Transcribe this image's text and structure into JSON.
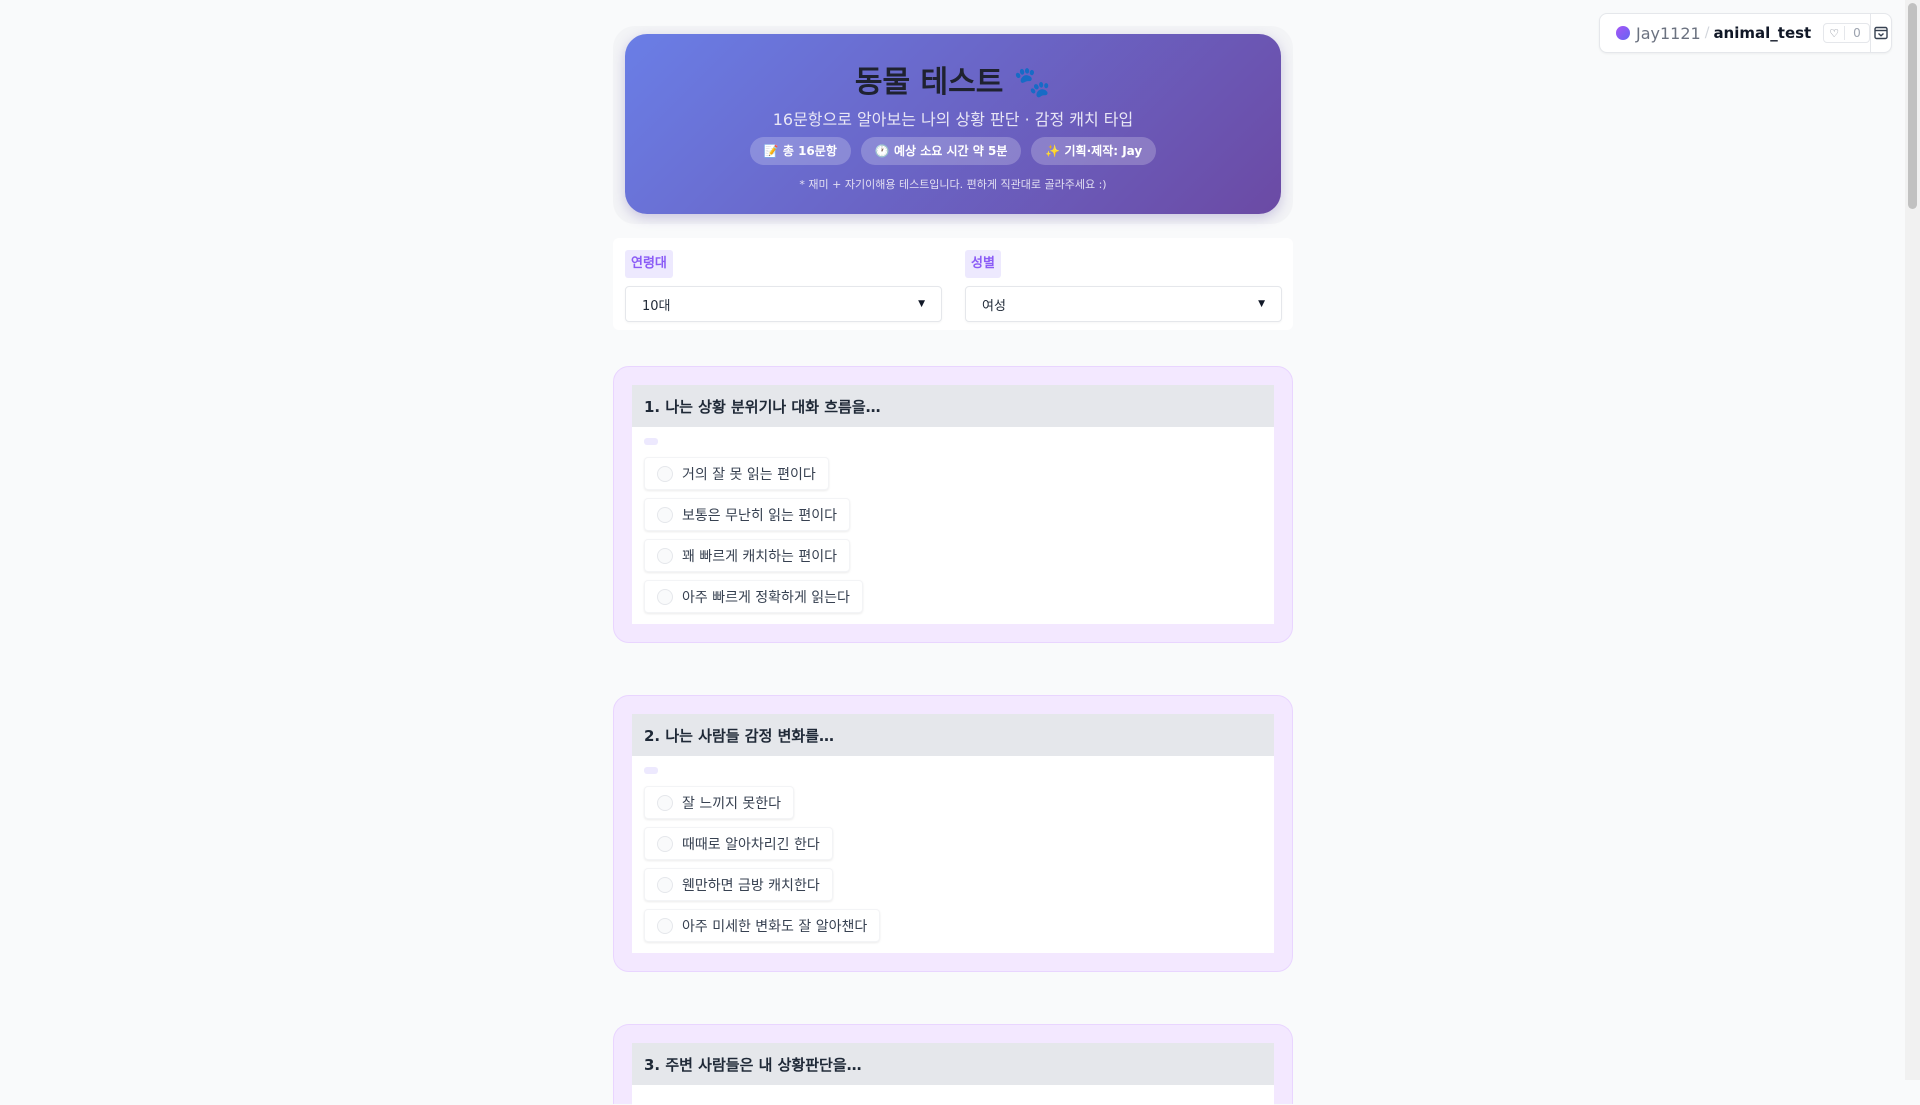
{
  "widget": {
    "user": "Jay1121",
    "separator": "/",
    "repo": "animal_test",
    "likes": "0"
  },
  "header": {
    "title": "동물 테스트 🐾",
    "subtitle": "16문항으로 알아보는 나의 상황 판단 · 감정 캐치 타입",
    "badges": [
      "📝 총 16문항",
      "🕐 예상 소요 시간 약 5분",
      "✨ 기획·제작: Jay"
    ],
    "note": "* 재미 + 자기이해용 테스트입니다. 편하게 직관대로 골라주세요 :)"
  },
  "selects": {
    "age": {
      "label": "연령대",
      "value": "10대"
    },
    "gender": {
      "label": "성별",
      "value": "여성"
    }
  },
  "questions": [
    {
      "title": "1. 나는 상황 분위기나 대화 흐름을…",
      "options": [
        "거의 잘 못 읽는 편이다",
        "보통은 무난히 읽는 편이다",
        "꽤 빠르게 캐치하는 편이다",
        "아주 빠르게 정확하게 읽는다"
      ]
    },
    {
      "title": "2. 나는 사람들 감정 변화를…",
      "options": [
        "잘 느끼지 못한다",
        "때때로 알아차리긴 한다",
        "웬만하면 금방 캐치한다",
        "아주 미세한 변화도 잘 알아챈다"
      ]
    },
    {
      "title": "3. 주변 사람들은 내 상황판단을…",
      "options": []
    }
  ],
  "colors": {
    "header_gradient_start": "#6a7ee6",
    "header_gradient_end": "#6b4aa4",
    "accent": "#8b5cf6",
    "card_bg": "#f3e8ff"
  }
}
